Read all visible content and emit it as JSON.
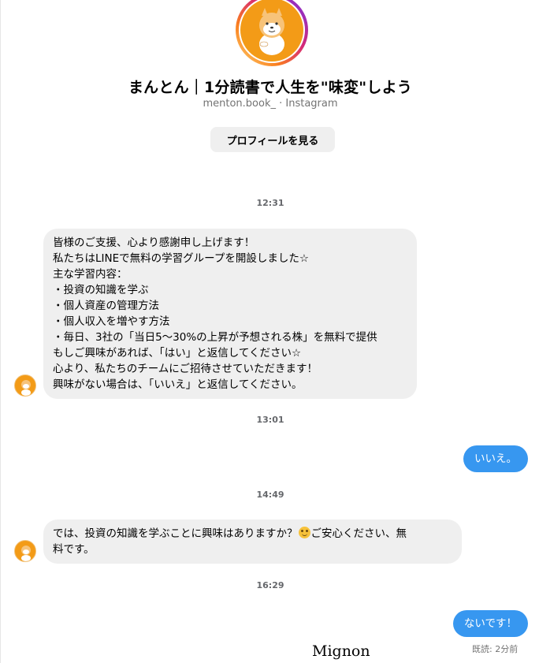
{
  "profile": {
    "name": "まんとん｜1分読書で人生を\"味変\"しよう",
    "username": "menton.book_",
    "platform": "Instagram",
    "separator": " · ",
    "view_profile_label": "プロフィールを見る",
    "avatar_icon": "shiba-dog-mascot-icon"
  },
  "messages": [
    {
      "time": "12:31",
      "direction": "incoming",
      "lines": [
        "皆様のご支援、心より感謝申し上げます！",
        "私たちはLINEで無料の学習グループを開設しました☆",
        "主な学習内容：",
        "・投資の知識を学ぶ",
        "・個人資産の管理方法",
        "・個人収入を増やす方法",
        "・毎日、3社の「当日5～30%の上昇が予想される株」を無料で提供",
        "もしご興味があれば、「はい」と返信してください☆",
        "心より、私たちのチームにご招待させていただきます！",
        "興味がない場合は、「いいえ」と返信してください。"
      ]
    },
    {
      "time": "13:01",
      "direction": "outgoing",
      "text": "いいえ。"
    },
    {
      "time": "14:49",
      "direction": "incoming",
      "line1_before_emoji": "では、投資の知識を学ぶことに興味はありますか？",
      "emoji_icon": "smiling-face-emoji-icon",
      "line1_after_emoji": "ご安心ください、無",
      "line2": "料です。"
    },
    {
      "time": "16:29",
      "direction": "outgoing",
      "text": "ないです！",
      "read_receipt": "既読: 2分前"
    }
  ],
  "watermark": "Mignon",
  "colors": {
    "outgoing_bubble": "#3797f0",
    "incoming_bubble": "#efefef",
    "avatar_orange": "#f39b17",
    "muted_text": "#737373"
  }
}
